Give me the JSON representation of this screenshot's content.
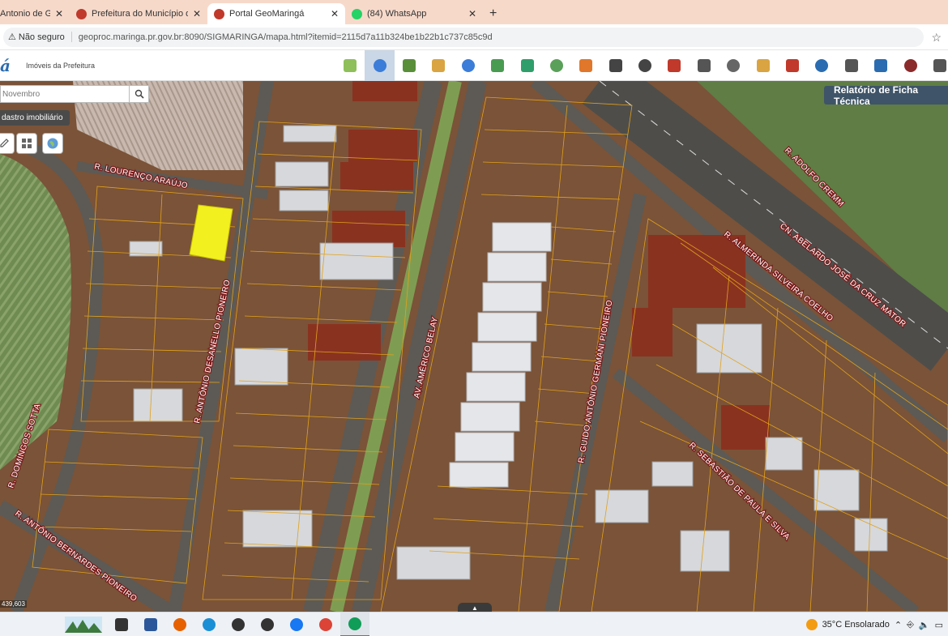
{
  "browser": {
    "tabs": [
      {
        "title": "Antonio de Gar",
        "favicon_color": "#2b6cb0",
        "active": false
      },
      {
        "title": "Prefeitura do Município de Ma",
        "favicon_color": "#c0392b",
        "active": false
      },
      {
        "title": "Portal GeoMaringá",
        "favicon_color": "#c0392b",
        "active": true
      },
      {
        "title": "(84) WhatsApp",
        "favicon_color": "#25d366",
        "active": false
      }
    ],
    "new_tab_symbol": "+",
    "security_label": "Não seguro",
    "url": "geoproc.maringa.pr.gov.br:8090/SIGMARINGA/mapa.html?itemid=2115d7a11b324be1b22b1c737c85c9d"
  },
  "app": {
    "logo_text": "á",
    "subtitle": "Imóveis da Prefeitura",
    "tools": [
      {
        "icon": "map-icon",
        "color": "#8fbf5a"
      },
      {
        "icon": "search-icon",
        "color": "#3b7dd8",
        "active": true
      },
      {
        "icon": "layers-icon",
        "color": "#5a8f3a"
      },
      {
        "icon": "draw-icon",
        "color": "#d9a441"
      },
      {
        "icon": "measure-icon",
        "color": "#3b7dd8"
      },
      {
        "icon": "book-icon",
        "color": "#4a9b52"
      },
      {
        "icon": "globe-icon",
        "color": "#2f9e6b"
      },
      {
        "icon": "puzzle-icon",
        "color": "#5aa05a"
      },
      {
        "icon": "target-icon",
        "color": "#e0772a"
      },
      {
        "icon": "binoculars-icon",
        "color": "#444444"
      },
      {
        "icon": "binoculars-alt-icon",
        "color": "#444444"
      },
      {
        "icon": "pin-icon",
        "color": "#c0392b"
      },
      {
        "icon": "list-icon",
        "color": "#555555"
      },
      {
        "icon": "pencil-icon",
        "color": "#666666"
      },
      {
        "icon": "ruler-icon",
        "color": "#d9a441"
      },
      {
        "icon": "people-icon",
        "color": "#c0392b"
      },
      {
        "icon": "car-icon",
        "color": "#2b6cb0"
      },
      {
        "icon": "print-icon",
        "color": "#555555"
      },
      {
        "icon": "world-icon",
        "color": "#2b6cb0"
      },
      {
        "icon": "book-open-icon",
        "color": "#8b2a2a"
      },
      {
        "icon": "expand-icon",
        "color": "#555555"
      }
    ]
  },
  "map": {
    "search_placeholder": "Novembro",
    "layer_label": "dastro imobiliário",
    "report_button": "Relatório de Ficha Técnica",
    "coordinates": "439,603",
    "streets": [
      "R. LOURENÇO ARAÚJO",
      "R. ANTÔNIO DESANELLO PIONEIRO",
      "R. DOMINGOS SOTTA",
      "R. ANTÔNIO BERNARDES PIONEIRO",
      "AV. AMÉRICO BELAY",
      "R. GUIDO ANTÔNIO GERMANI PIONEIRO",
      "R. ALMERINDA SILVEIRA COELHO",
      "R. ADOLFO CREMM",
      "CN. ABELARDO JOSÉ DA CRUZ MATOR",
      "R. SEBASTIÃO DE PAULA E SILVA"
    ],
    "highlight_color": "#f3f01f"
  },
  "taskbar": {
    "apps": [
      "task-view-icon",
      "word-icon",
      "firefox-icon",
      "edge-icon",
      "store-icon",
      "mail-icon",
      "facebook-icon",
      "chrome-icon",
      "chrome-profile-icon"
    ],
    "weather": "35°C  Ensolarado"
  }
}
